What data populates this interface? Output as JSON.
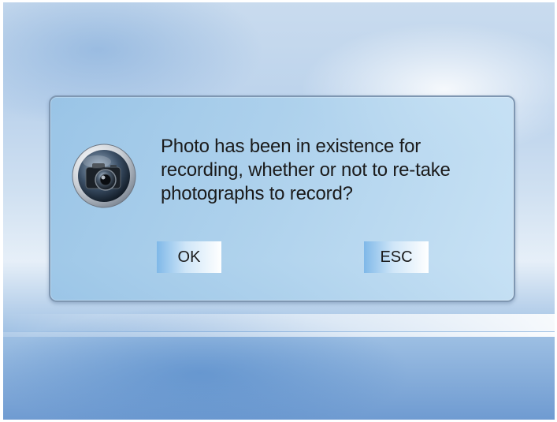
{
  "dialog": {
    "message": "Photo has been in existence for recording, whether or not to re-take photographs to record?",
    "icon": "camera-icon",
    "ok_label": "OK",
    "esc_label": "ESC"
  },
  "colors": {
    "dialog_border": "#7f97b2",
    "dialog_fill": "#a8d0ec",
    "button_start": "#7fb8e8",
    "button_end": "#ffffff",
    "text": "#1b1b1b"
  }
}
